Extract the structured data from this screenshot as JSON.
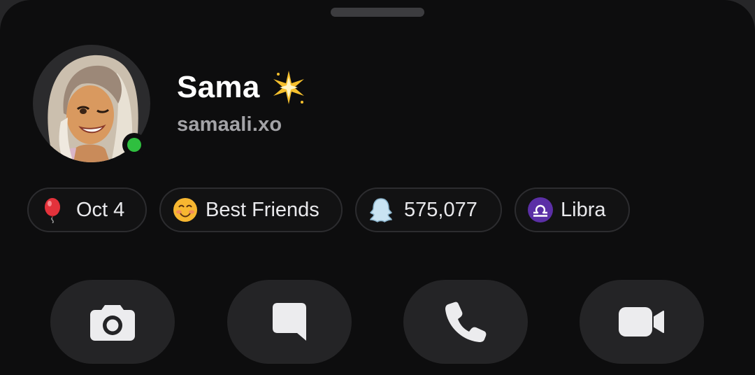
{
  "profile": {
    "display_name": "Sama",
    "username": "samaali.xo",
    "online": true,
    "online_color": "#2fbf3f",
    "name_badge_icon": "sparkle-icon"
  },
  "chips": {
    "birthday": {
      "icon": "balloon-icon",
      "label": "Oct 4"
    },
    "friendship": {
      "icon": "smiling-face-icon",
      "label": "Best Friends"
    },
    "snapscore": {
      "icon": "ghost-icon",
      "label": "575,077"
    },
    "zodiac": {
      "icon": "libra-icon",
      "label": "Libra"
    }
  },
  "actions": [
    {
      "icon": "camera-icon"
    },
    {
      "icon": "chat-icon"
    },
    {
      "icon": "phone-icon"
    },
    {
      "icon": "video-camera-icon"
    }
  ],
  "colors": {
    "background": "#0d0d0e",
    "chip_border": "#2c2c2f",
    "button_bg": "#242426",
    "zodiac_accent": "#5b2fa6"
  }
}
